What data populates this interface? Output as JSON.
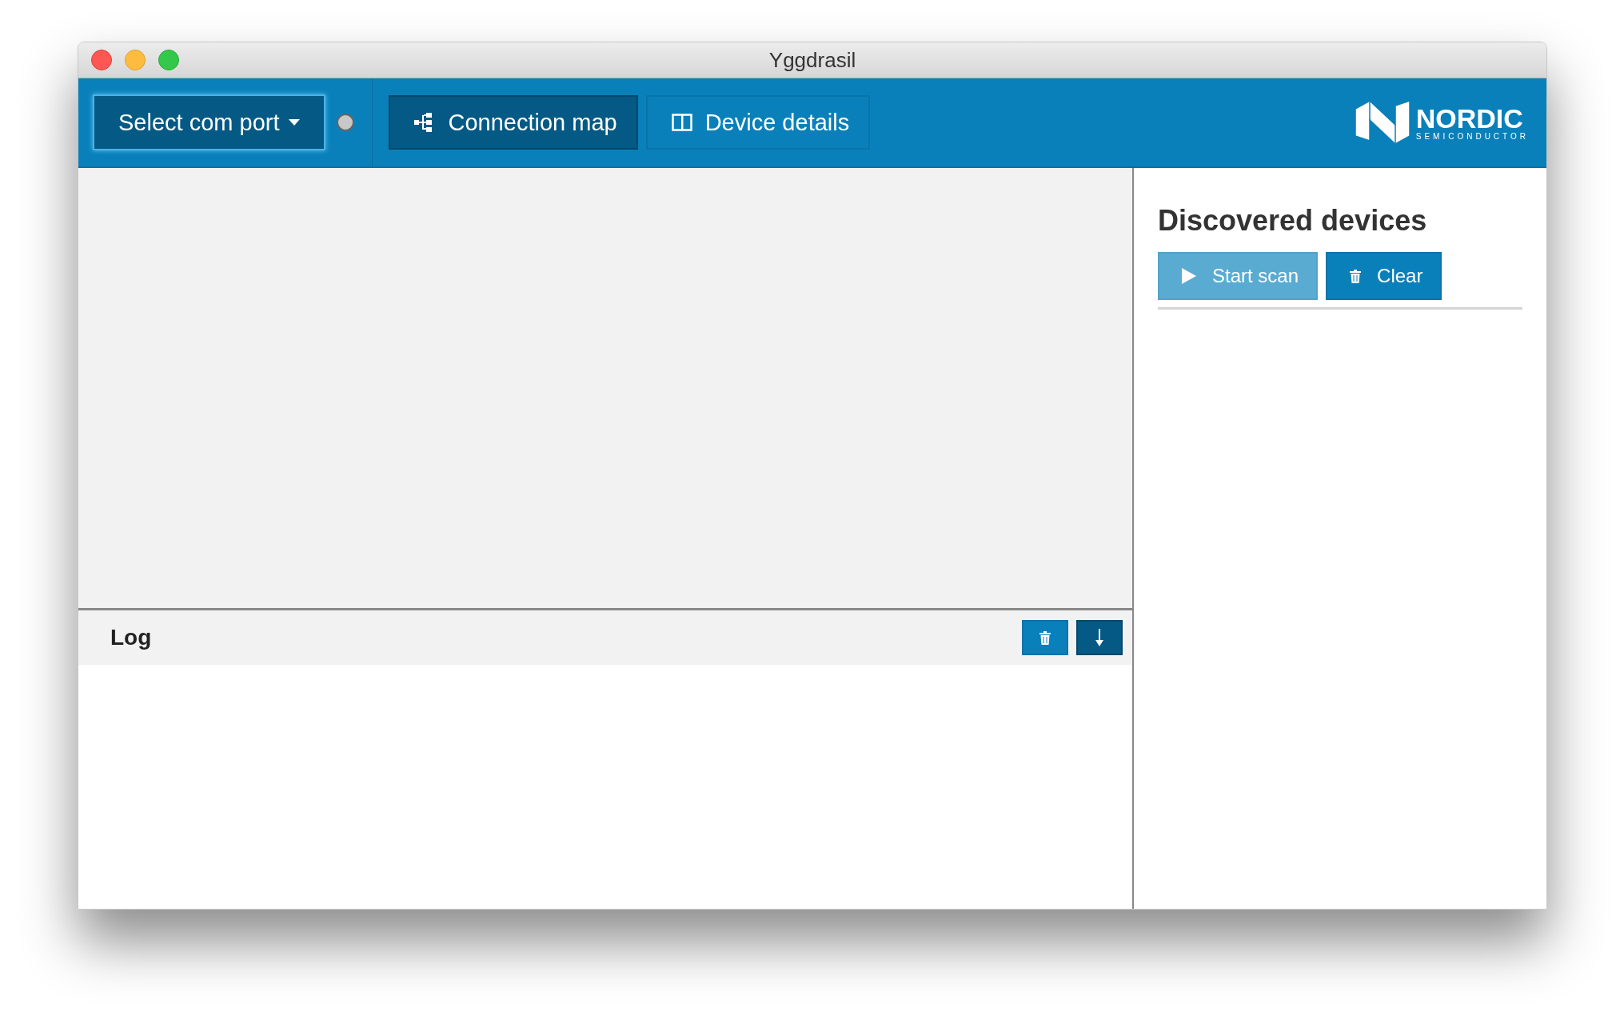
{
  "window": {
    "title": "Yggdrasil"
  },
  "toolbar": {
    "port_select": {
      "label": "Select com port"
    },
    "connected": false,
    "tabs": [
      {
        "label": "Connection map",
        "kind": "map",
        "selected": true
      },
      {
        "label": "Device details",
        "kind": "details",
        "selected": false
      }
    ],
    "logo": {
      "name": "NORDIC",
      "tagline": "SEMICONDUCTOR"
    }
  },
  "log": {
    "title": "Log",
    "autoscroll": true
  },
  "discovered_devices": {
    "title": "Discovered devices",
    "buttons": [
      {
        "label": "Start scan",
        "kind": "scan",
        "disabled": true
      },
      {
        "label": "Clear",
        "kind": "clear",
        "disabled": false
      }
    ]
  }
}
